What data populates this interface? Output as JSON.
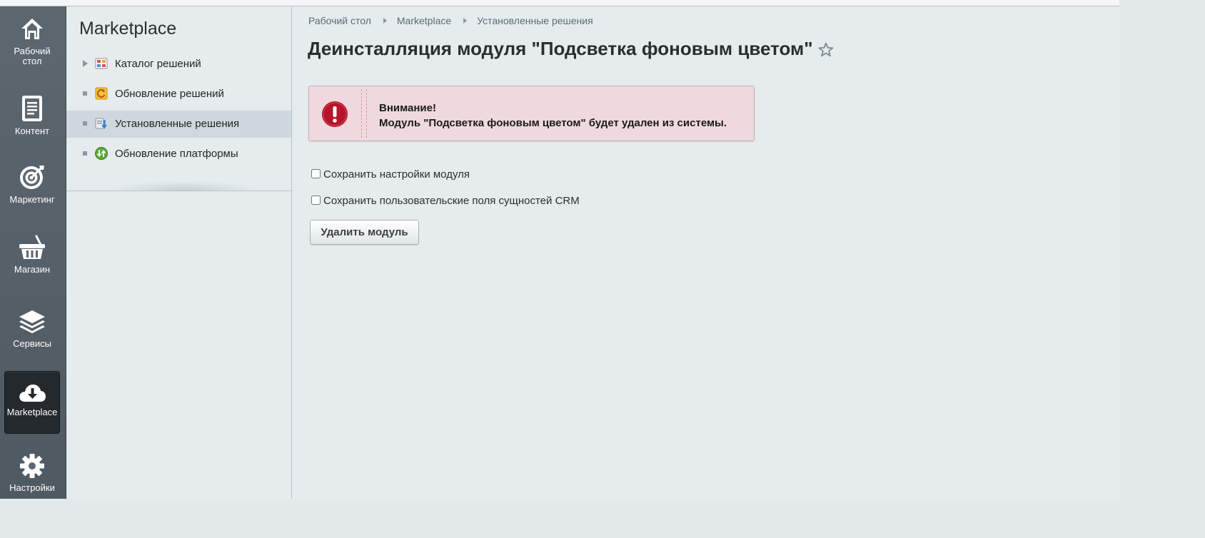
{
  "rail": {
    "items": [
      {
        "label": "Рабочий стол",
        "icon": "home-icon"
      },
      {
        "label": "Контент",
        "icon": "document-icon"
      },
      {
        "label": "Маркетинг",
        "icon": "target-icon"
      },
      {
        "label": "Магазин",
        "icon": "basket-icon"
      },
      {
        "label": "Сервисы",
        "icon": "layers-icon"
      },
      {
        "label": "Marketplace",
        "icon": "cloud-download-icon",
        "active": true
      },
      {
        "label": "Настройки",
        "icon": "gear-icon"
      }
    ]
  },
  "menu": {
    "title": "Marketplace",
    "items": [
      {
        "label": "Каталог решений",
        "icon": "catalog-icon"
      },
      {
        "label": "Обновление решений",
        "icon": "update-icon"
      },
      {
        "label": "Установленные решения",
        "icon": "installed-icon",
        "active": true
      },
      {
        "label": "Обновление платформы",
        "icon": "platform-update-icon"
      }
    ]
  },
  "breadcrumb": [
    "Рабочий стол",
    "Marketplace",
    "Установленные решения"
  ],
  "page": {
    "title": "Деинсталляция модуля \"Подсветка фоновым цветом\"",
    "favorite_icon": "star-icon"
  },
  "alert": {
    "heading": "Внимание!",
    "message": "Модуль \"Подсветка фоновым цветом\" будет удален из системы.",
    "icon": "exclamation-icon",
    "accent": "#b5142a"
  },
  "form": {
    "checkbox_settings": "Сохранить настройки модуля",
    "checkbox_crm": "Сохранить пользовательские поля сущностей CRM",
    "submit": "Удалить модуль"
  }
}
